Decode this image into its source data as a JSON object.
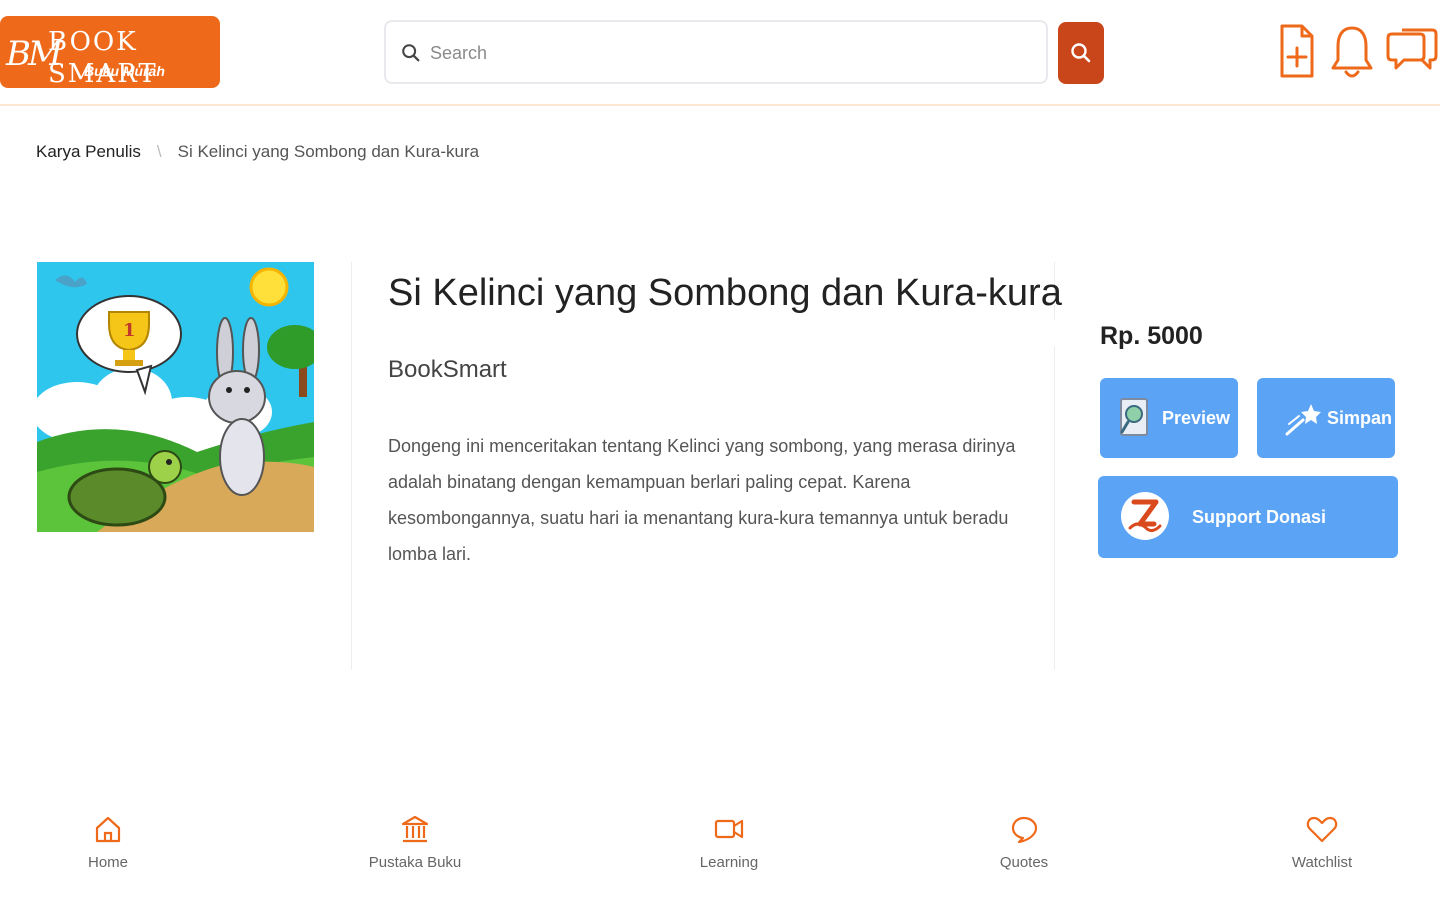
{
  "header": {
    "logo": {
      "mark": "BM",
      "name": "BOOK SMART",
      "subtitle": "Buku Murah"
    },
    "search": {
      "placeholder": "Search",
      "value": ""
    },
    "search_button_icon": "search-icon",
    "icons": [
      "file-add-icon",
      "bell-icon",
      "chat-icon"
    ]
  },
  "breadcrumb": {
    "root": "Karya Penulis",
    "separator": "\\",
    "current": "Si Kelinci yang Sombong dan Kura-kura"
  },
  "book": {
    "cover_alt": "book-cover",
    "title": "Si Kelinci yang Sombong dan Kura-kura",
    "author": "BookSmart",
    "description": "Dongeng ini menceritakan tentang Kelinci yang sombong, yang merasa dirinya adalah binatang dengan kemampuan berlari paling cepat. Karena kesombongannya, suatu hari ia menantang kura-kura temannya untuk beradu lomba lari."
  },
  "sidebar": {
    "price": "Rp. 5000",
    "preview_label": "Preview",
    "simpan_label": "Simpan",
    "donasi_label": "Support Donasi"
  },
  "bottom_nav": [
    {
      "label": "Home",
      "icon": "home-icon"
    },
    {
      "label": "Pustaka Buku",
      "icon": "library-icon"
    },
    {
      "label": "Learning",
      "icon": "video-icon"
    },
    {
      "label": "Quotes",
      "icon": "quote-bubble-icon"
    },
    {
      "label": "Watchlist",
      "icon": "heart-icon"
    }
  ],
  "colors": {
    "brand_orange": "#ee6a1a",
    "search_button": "#c9461b",
    "action_blue": "#5aa3f5",
    "header_border": "#fde6d2"
  }
}
